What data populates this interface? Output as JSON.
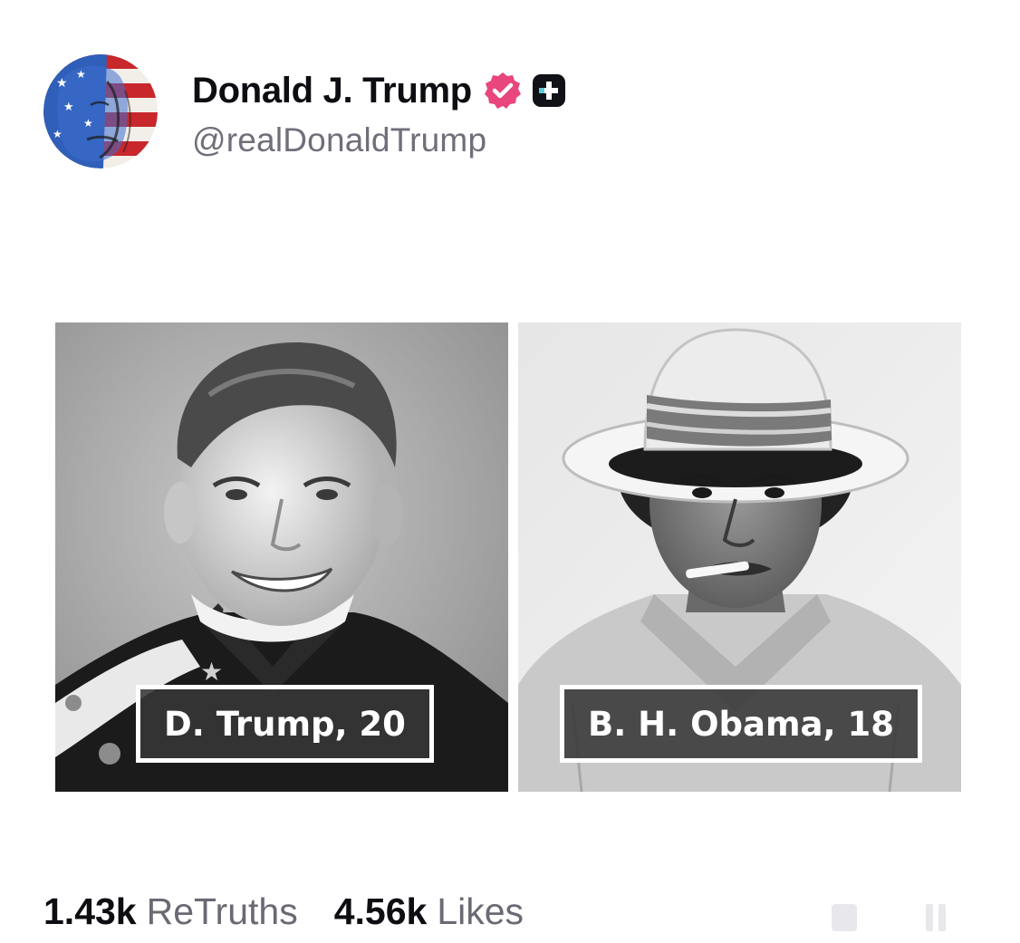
{
  "post": {
    "author": {
      "display_name": "Donald J. Trump",
      "handle": "@realDonaldTrump",
      "verified_color": "#e8467c",
      "avatar_icon": "flag-face-avatar"
    },
    "media": [
      {
        "caption": "D. Trump, 20",
        "tone": "black-and-white"
      },
      {
        "caption": "B. H. Obama, 18",
        "tone": "black-and-white"
      }
    ],
    "stats": {
      "retruths_count": "1.43k",
      "retruths_label": "ReTruths",
      "likes_count": "4.56k",
      "likes_label": "Likes"
    }
  },
  "colors": {
    "text_primary": "#0d0d12",
    "text_secondary": "#6f6f7a",
    "badge_pink": "#e8467c",
    "badge_dark": "#111118"
  }
}
